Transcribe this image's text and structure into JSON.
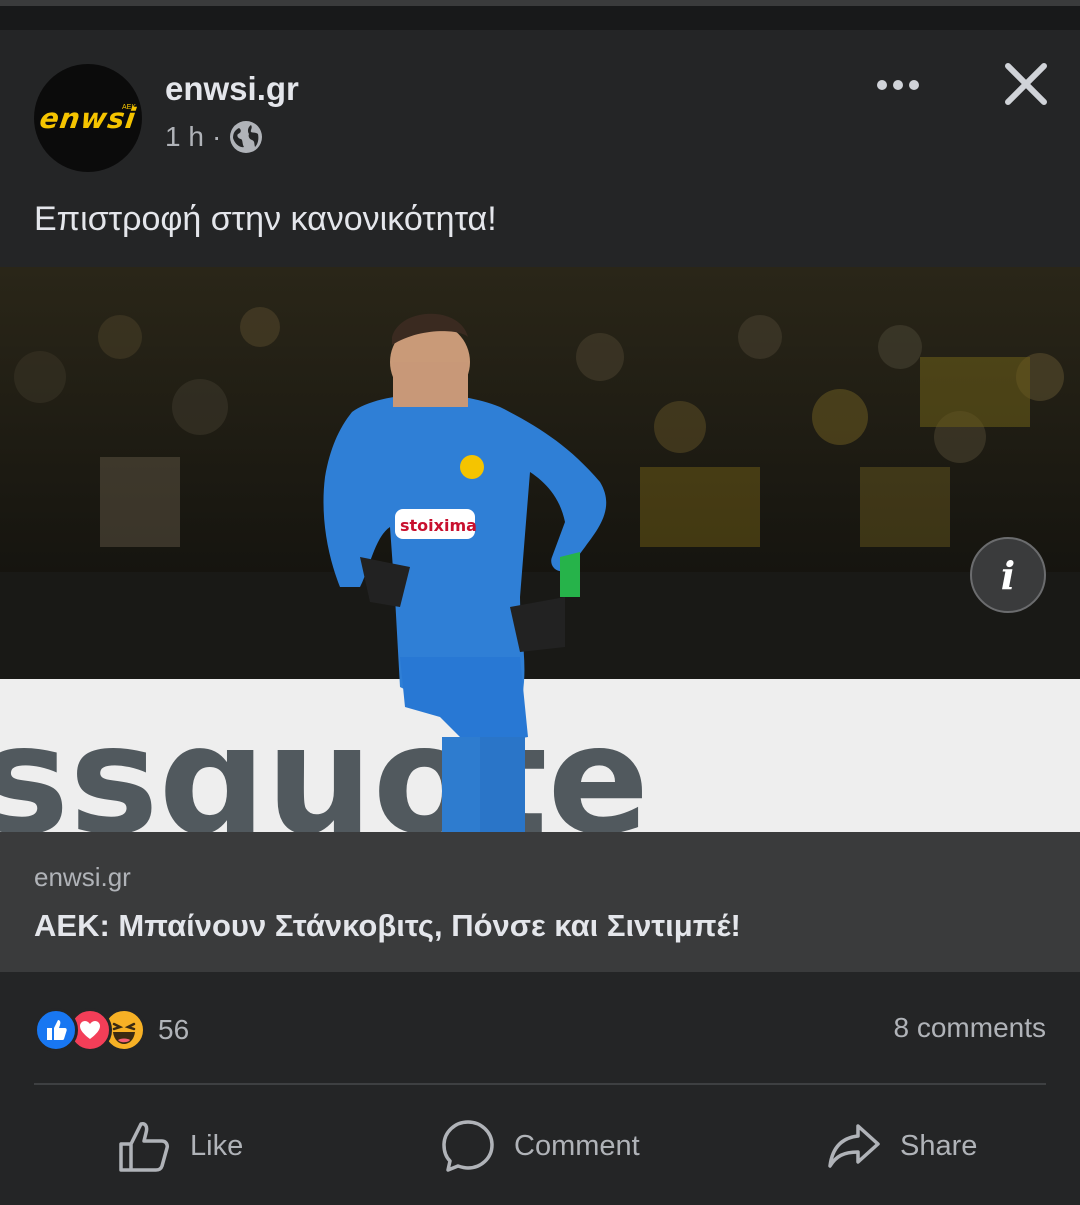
{
  "post": {
    "page_name": "enwsi.gr",
    "time": "1 h",
    "separator": "·",
    "logo_text": "enwsi",
    "logo_mini": "AEK",
    "text": "Επιστροφή στην κανονικότητα!"
  },
  "photo": {
    "info_label": "i",
    "banner_text": "ssquote"
  },
  "link": {
    "domain": "enwsi.gr",
    "title": "ΑΕΚ: Μπαίνουν Στάνκοβιτς, Πόνσε και Σιντιμπέ!"
  },
  "stats": {
    "reactions_count": "56",
    "comments": "8 comments",
    "reaction_icons": [
      "like-icon",
      "love-icon",
      "haha-icon"
    ]
  },
  "actions": {
    "like": "Like",
    "comment": "Comment",
    "share": "Share"
  },
  "colors": {
    "background": "#242526",
    "link_box": "#3a3b3c",
    "like_blue": "#1877f2",
    "love_red": "#f33e58",
    "haha_yellow": "#f7b125",
    "logo_yellow": "#f5c400"
  }
}
